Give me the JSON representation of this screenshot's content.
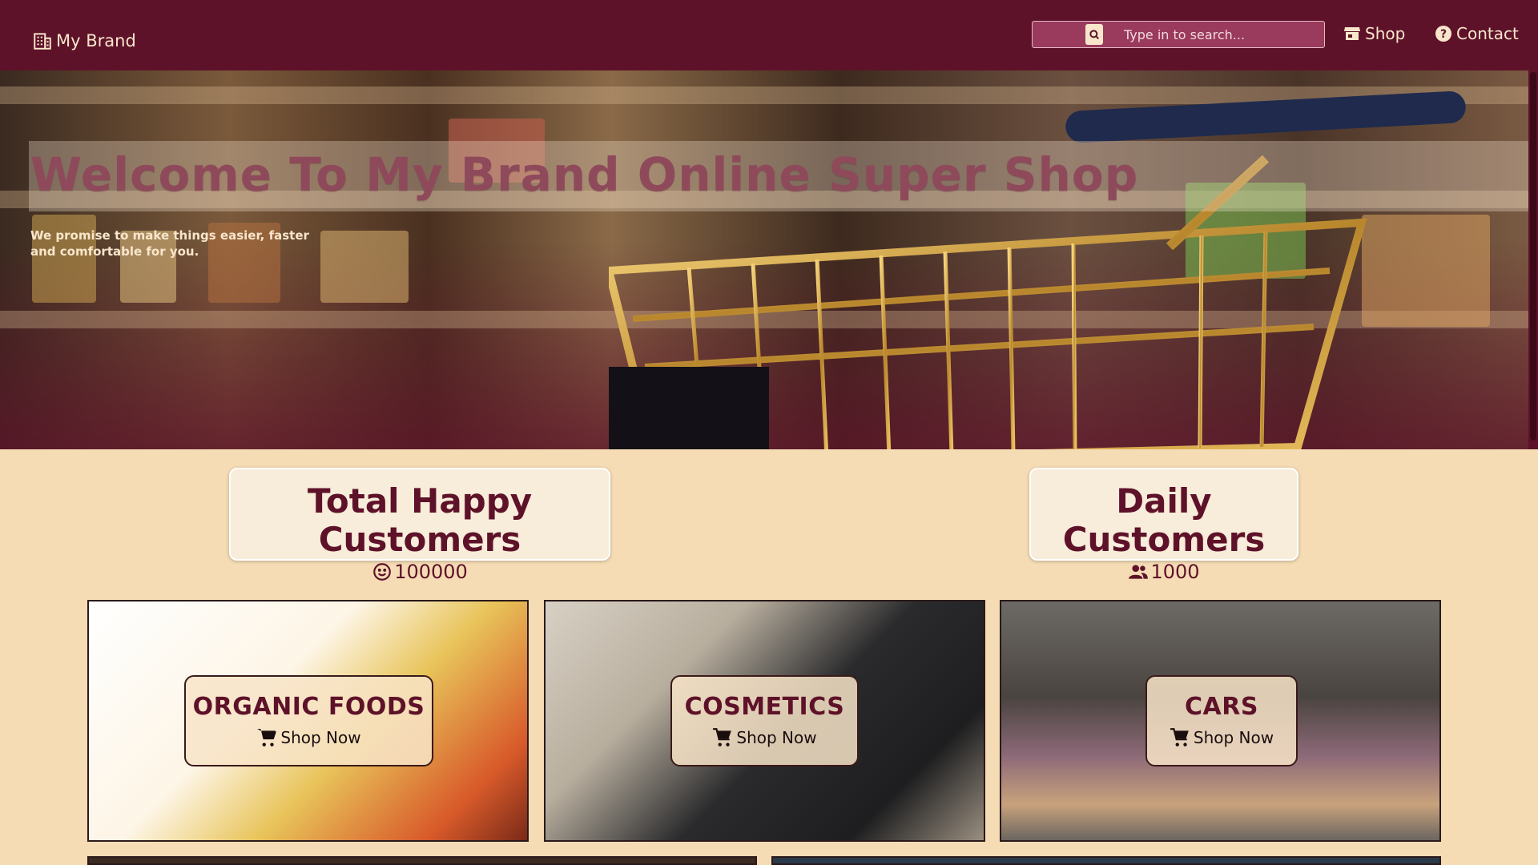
{
  "header": {
    "brand": "My Brand",
    "search_placeholder": "Type in to search...",
    "nav": [
      {
        "label": "Shop",
        "icon": "store-icon"
      },
      {
        "label": "Contact",
        "icon": "help-circle-icon"
      }
    ]
  },
  "hero": {
    "title": "Welcome To My Brand Online Super Shop",
    "subtitle": "We promise to make things easier, faster and comfortable for you."
  },
  "stats": [
    {
      "title": "Total Happy Customers",
      "value": "100000",
      "icon": "smile-icon"
    },
    {
      "title": "Daily Customers",
      "value": "1000",
      "icon": "people-icon"
    }
  ],
  "categories": [
    {
      "title": "ORGANIC FOODS",
      "button": "Shop Now"
    },
    {
      "title": "COSMETICS",
      "button": "Shop Now"
    },
    {
      "title": "CARS",
      "button": "Shop Now"
    }
  ],
  "colors": {
    "primary": "#5e1229",
    "background": "#f5dcb5",
    "text_light": "#f8e6cc"
  }
}
